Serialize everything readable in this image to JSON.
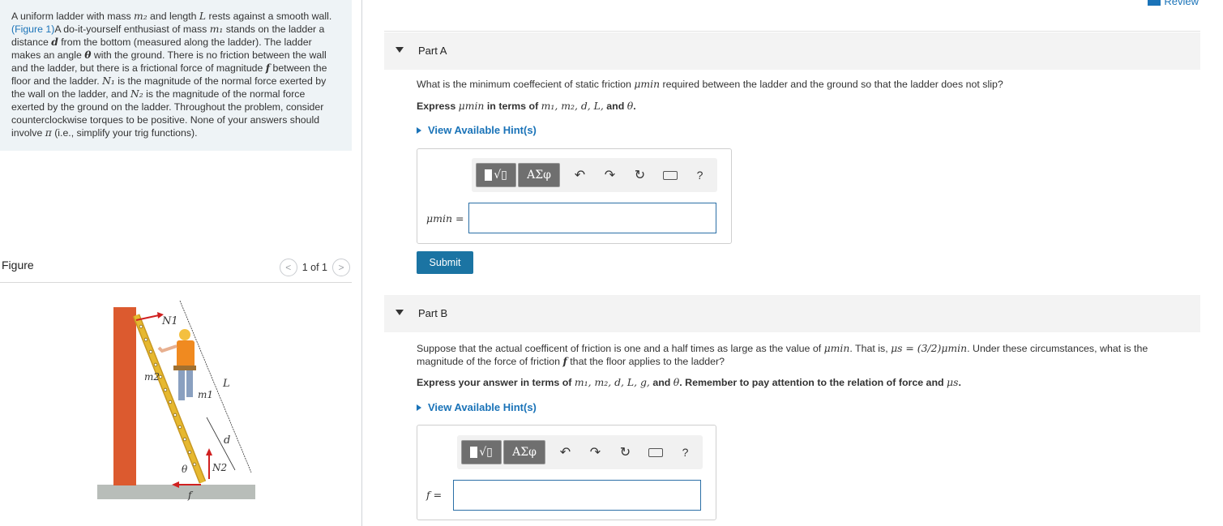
{
  "problem": {
    "text_parts": {
      "a": "A uniform ladder with mass ",
      "m2": "m₂",
      "b": " and length ",
      "L": "L",
      "c": " rests against a smooth wall. ",
      "fig_link": "(Figure 1)",
      "d": "A do-it-yourself enthusiast of mass ",
      "m1": "m₁",
      "e": " stands on the ladder a distance ",
      "dvar": "d",
      "f": " from the bottom (measured along the ladder). The ladder makes an angle ",
      "theta": "θ",
      "g": " with the ground. There is no friction between the wall and the ladder, but there is a frictional force of magnitude ",
      "fvar": "f",
      "h": " between the floor and the ladder. ",
      "N1": "N₁",
      "i": " is the magnitude of the normal force exerted by the wall on the ladder, and ",
      "N2": "N₂",
      "j": " is the magnitude of the normal force exerted by the ground on the ladder. Throughout the problem, consider counterclockwise torques to be positive. None of your answers should involve ",
      "pi": "π",
      "k": " (i.e., simplify your trig functions)."
    }
  },
  "figure": {
    "title": "Figure",
    "pager": "1 of 1",
    "labels": {
      "N1": "N1",
      "m2": "m2",
      "m1": "m1",
      "L": "L",
      "d": "d",
      "theta": "θ",
      "N2": "N2",
      "f": "f"
    }
  },
  "review": "Review",
  "partA": {
    "title": "Part A",
    "question_pre": "What is the minimum coeffecient of static friction ",
    "mu_min": "μmin",
    "question_post": " required between the ladder and the ground so that the ladder does not slip?",
    "express_pre": "Express ",
    "express_mu": "μmin",
    "express_mid": " in terms of ",
    "express_vars": "m₁, m₂, d, L,",
    "express_and": " and ",
    "express_theta": "θ",
    "express_end": ".",
    "hint": "View Available Hint(s)",
    "answer_label": "μmin =",
    "submit": "Submit"
  },
  "partB": {
    "title": "Part B",
    "q1": "Suppose that the actual coefficent of friction is one and a half times as large as the value of ",
    "q_mu": "μmin",
    "q2": ". That is, ",
    "q_eq": "μs = (3/2)μmin",
    "q3": ". Under these circumstances, what is the magnitude of the force of friction ",
    "q_f": "f",
    "q4": " that the floor applies to the ladder?",
    "express_pre": "Express your answer in terms of ",
    "express_vars": "m₁, m₂, d, L, g,",
    "express_and": " and ",
    "express_theta": "θ",
    "express_post": ". Remember to pay attention to the relation of force and ",
    "express_mus": "μs",
    "express_end": ".",
    "hint": "View Available Hint(s)",
    "answer_label": "f ="
  },
  "toolbar": {
    "greek": "ΑΣφ",
    "root": "√▯",
    "undo": "↶",
    "redo": "↷",
    "reset": "↻",
    "help": "?"
  },
  "colors": {
    "wall": "#dc5a2f",
    "ladder": "#e6b830",
    "arrow": "#d02020",
    "accent": "#1a73b8",
    "button": "#1b74a3"
  }
}
